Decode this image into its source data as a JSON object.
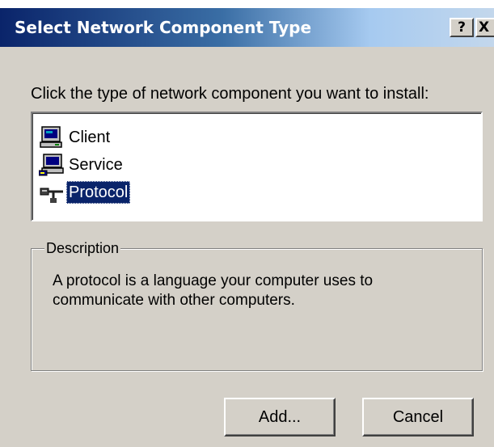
{
  "window": {
    "title": "Select Network Component Type",
    "help_label": "?",
    "close_label": "X"
  },
  "prompt": "Click the type of network component you want to install:",
  "list": {
    "items": [
      {
        "label": "Client",
        "icon": "client-computer-icon",
        "selected": false
      },
      {
        "label": "Service",
        "icon": "service-computer-icon",
        "selected": false
      },
      {
        "label": "Protocol",
        "icon": "protocol-cable-icon",
        "selected": true
      }
    ]
  },
  "description": {
    "legend": "Description",
    "text": "A protocol is a language your computer uses to communicate with other computers."
  },
  "buttons": {
    "add": "Add...",
    "cancel": "Cancel"
  },
  "colors": {
    "titlebar_start": "#0a246a",
    "titlebar_end": "#a6caf0",
    "face": "#d4d0c8",
    "selection": "#0a246a"
  }
}
